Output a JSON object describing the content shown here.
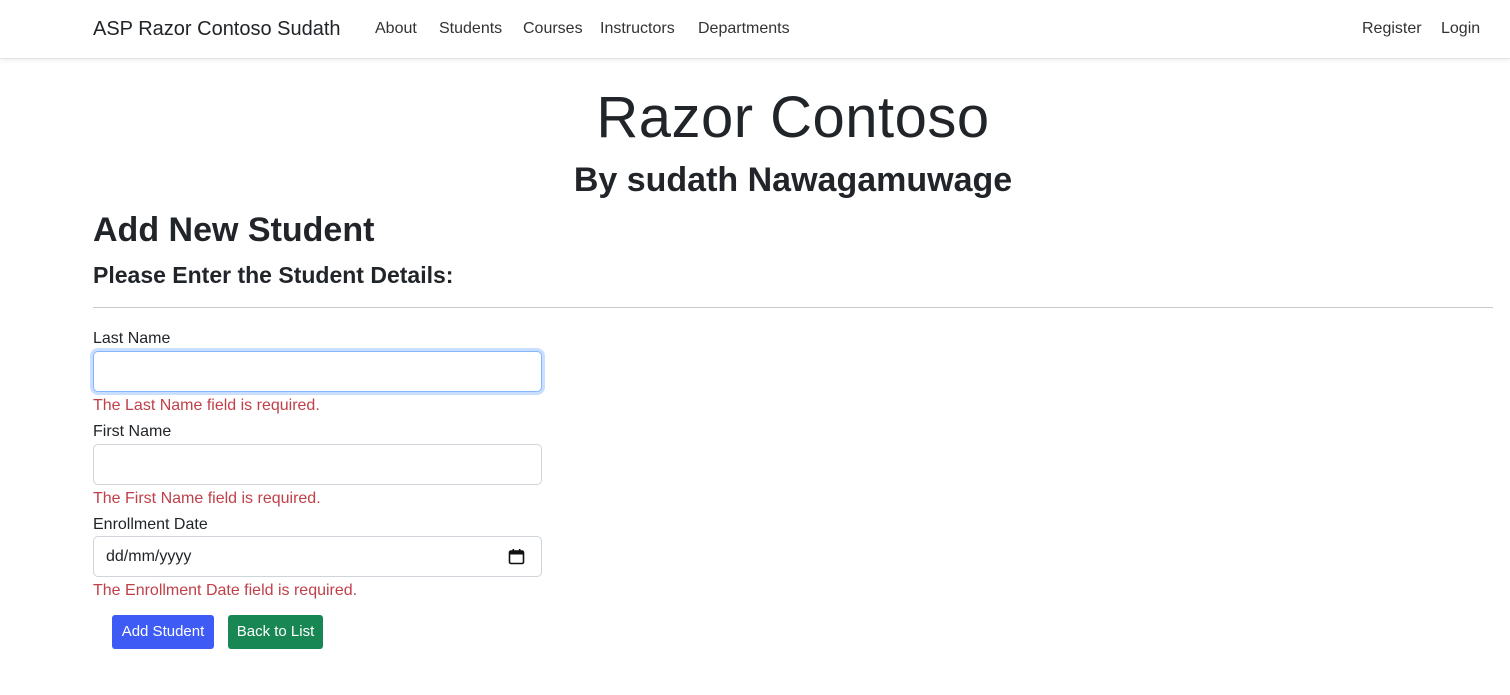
{
  "navbar": {
    "brand": "ASP Razor Contoso Sudath",
    "links": [
      "About",
      "Students",
      "Courses",
      "Instructors",
      "Departments"
    ],
    "right_links": [
      "Register",
      "Login"
    ]
  },
  "header": {
    "title": "Razor Contoso",
    "subtitle": "By sudath Nawagamuwage"
  },
  "page": {
    "heading": "Add New Student",
    "subheading": "Please Enter the Student Details:"
  },
  "form": {
    "last_name": {
      "label": "Last Name",
      "value": "",
      "error": "The Last Name field is required."
    },
    "first_name": {
      "label": "First Name",
      "value": "",
      "error": "The First Name field is required."
    },
    "enrollment_date": {
      "label": "Enrollment Date",
      "placeholder": "dd/mm/yyyy",
      "error": "The Enrollment Date field is required."
    },
    "submit_label": "Add Student",
    "back_label": "Back to List"
  },
  "colors": {
    "error": "#c0404a",
    "primary": "#3e5bf5",
    "success": "#198754",
    "focus_border": "#86b7fe"
  },
  "icons": {
    "date_picker": "calendar-icon"
  }
}
